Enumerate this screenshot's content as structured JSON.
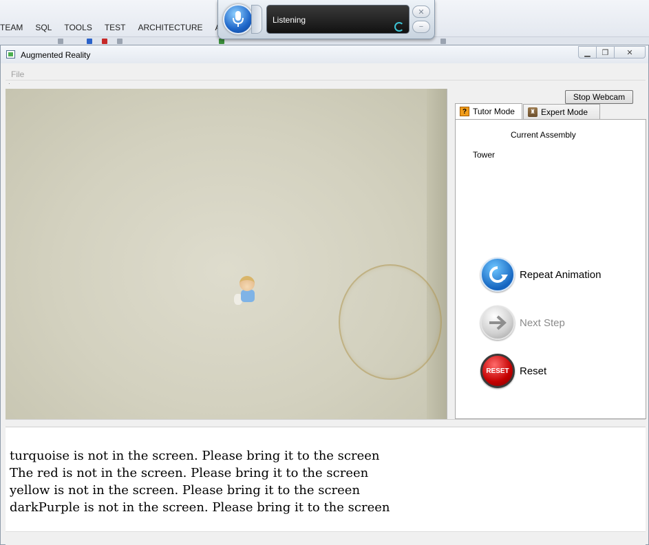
{
  "ide": {
    "menus": [
      "TEAM",
      "SQL",
      "TOOLS",
      "TEST",
      "ARCHITECTURE",
      "ANA"
    ]
  },
  "speech": {
    "status": "Listening"
  },
  "window": {
    "title": "Augmented Reality",
    "menu": {
      "file": "File"
    }
  },
  "panel": {
    "stop_webcam": "Stop Webcam",
    "tabs": [
      {
        "label": "Tutor Mode",
        "icon": "question-block-icon",
        "selected": true
      },
      {
        "label": "Expert Mode",
        "icon": "expert-figure-icon",
        "selected": false
      }
    ],
    "current_assembly_label": "Current Assembly",
    "assembly_name": "Tower",
    "actions": [
      {
        "label": "Repeat Animation",
        "icon": "repeat-icon",
        "enabled": true
      },
      {
        "label": "Next Step",
        "icon": "arrow-right-icon",
        "enabled": false
      },
      {
        "label": "Reset",
        "icon": "reset-icon",
        "icon_text": "RESET",
        "enabled": true
      }
    ]
  },
  "messages": [
    "turquoise is not in the screen. Please bring it to the screen",
    "The red is not in the screen. Please bring it to the screen",
    "yellow is not in the screen. Please bring it to the screen",
    "darkPurple is not in the screen. Please bring it to the screen"
  ],
  "colors": {
    "accent_blue": "#1565c0",
    "reset_red": "#c40000",
    "disabled_text": "#8a8a8a"
  }
}
